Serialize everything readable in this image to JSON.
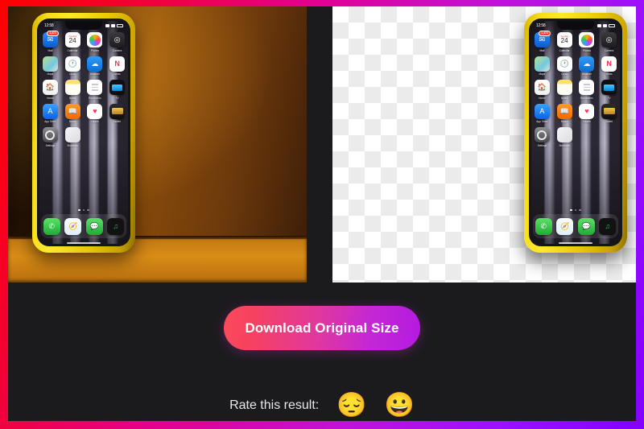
{
  "app": {
    "background_color": "#1b1b1e",
    "frame_gradient_start": "#ff0000",
    "frame_gradient_end": "#8400ff"
  },
  "comparison": {
    "left_pane_name": "original-image",
    "right_pane_name": "background-removed-image",
    "subject": "yellow-cased iPhone standing against an orange wall",
    "left_background_description": "warm orange wall with orange floor",
    "right_background_description": "transparency checkerboard"
  },
  "phone": {
    "status_time": "12:58",
    "page_dots": 3,
    "active_page": 1,
    "rows": [
      [
        {
          "label": "Mail",
          "icon": "mail-icon",
          "badge": "1,472"
        },
        {
          "label": "Calendar",
          "icon": "calendar-icon",
          "day": "24",
          "weekday": "Tuesday"
        },
        {
          "label": "Photos",
          "icon": "photos-icon"
        },
        {
          "label": "Camera",
          "icon": "camera-icon"
        }
      ],
      [
        {
          "label": "Maps",
          "icon": "maps-icon"
        },
        {
          "label": "Clock",
          "icon": "clock-icon"
        },
        {
          "label": "Weather",
          "icon": "weather-icon"
        },
        {
          "label": "News",
          "icon": "news-icon"
        }
      ],
      [
        {
          "label": "Home",
          "icon": "home-icon"
        },
        {
          "label": "Notes",
          "icon": "notes-icon"
        },
        {
          "label": "Reminders",
          "icon": "reminders-icon"
        },
        {
          "label": "TV",
          "icon": "tv-icon"
        }
      ],
      [
        {
          "label": "App Store",
          "icon": "app-store-icon"
        },
        {
          "label": "Books",
          "icon": "books-icon"
        },
        {
          "label": "Health",
          "icon": "health-icon"
        },
        {
          "label": "Wallet",
          "icon": "wallet-icon"
        }
      ],
      [
        {
          "label": "Settings",
          "icon": "settings-icon"
        },
        {
          "label": "Shortcuts",
          "icon": "shortcuts-icon"
        }
      ]
    ],
    "dock": [
      {
        "label": "Phone",
        "icon": "phone-icon",
        "glyph": "✆"
      },
      {
        "label": "Safari",
        "icon": "safari-icon",
        "glyph": "➤"
      },
      {
        "label": "Messages",
        "icon": "messages-icon",
        "glyph": "●"
      },
      {
        "label": "Spotify",
        "icon": "spotify-icon",
        "glyph": "♫"
      }
    ]
  },
  "download": {
    "label": "Download Original Size",
    "gradient_start": "#fb4a5c",
    "gradient_end": "#b31be0"
  },
  "rating": {
    "label": "Rate this result:",
    "options": [
      {
        "name": "rate-bad",
        "emoji": "😔",
        "meaning": "pensive-face"
      },
      {
        "name": "rate-good",
        "emoji": "😀",
        "meaning": "grinning-face"
      }
    ]
  }
}
